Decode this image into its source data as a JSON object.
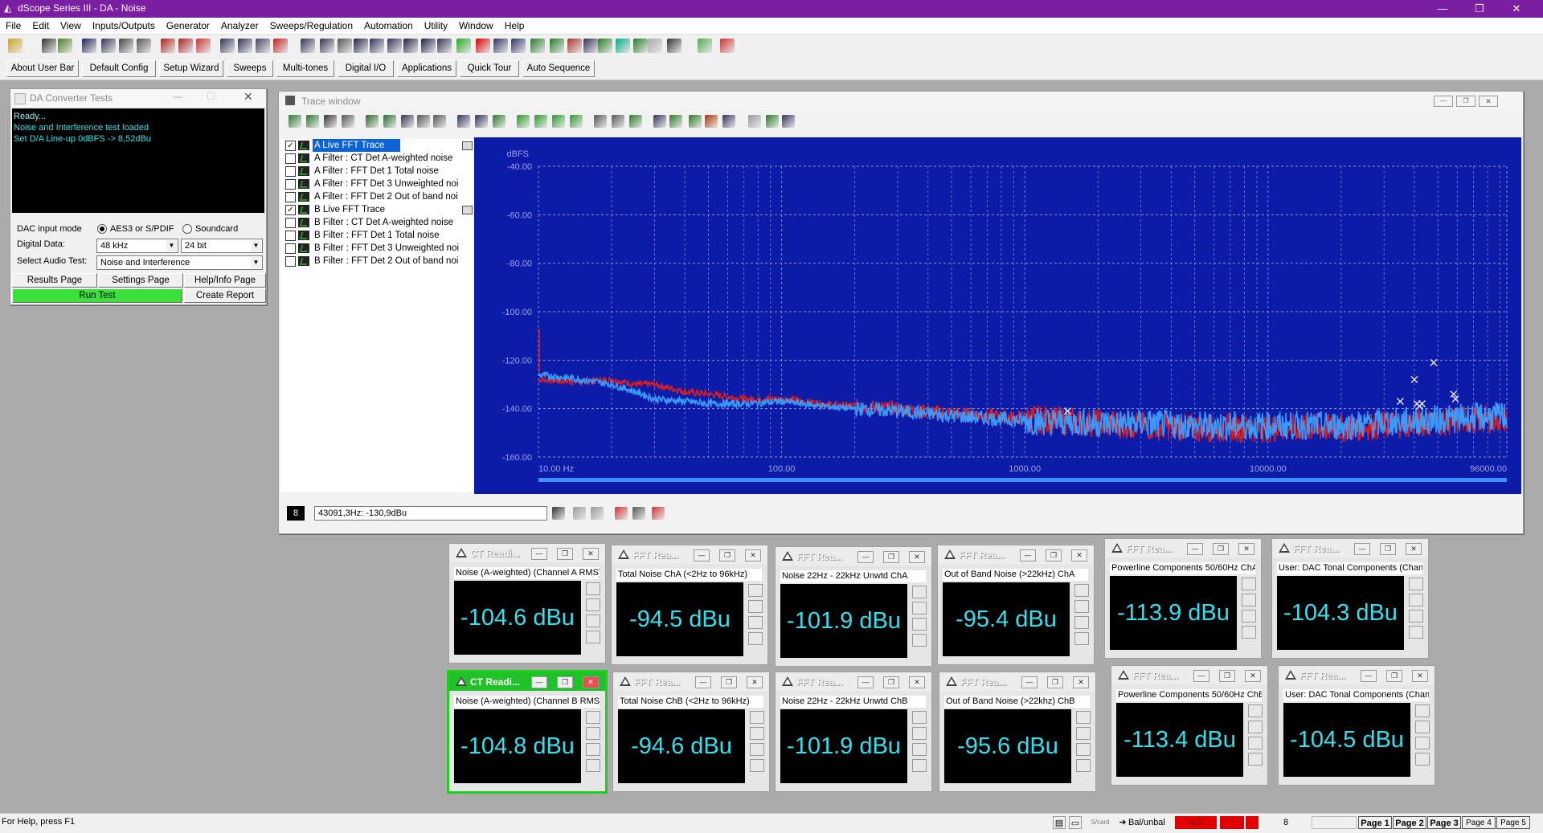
{
  "app": {
    "title": "dScope Series III - DA - Noise"
  },
  "menu": [
    "File",
    "Edit",
    "View",
    "Inputs/Outputs",
    "Generator",
    "Analyzer",
    "Sweeps/Regulation",
    "Automation",
    "Utility",
    "Window",
    "Help"
  ],
  "userbar": [
    "About User Bar",
    "Default Config",
    "Setup Wizard",
    "Sweeps",
    "Multi-tones",
    "Digital I/O",
    "Applications",
    "Quick Tour",
    "Auto Sequence"
  ],
  "da_panel": {
    "title": "DA Converter Tests",
    "log": [
      "Ready...",
      "Noise and Interference test loaded",
      "Set D/A Line-up 0dBFS -> 8,52dBu"
    ],
    "dac_input_label": "DAC input mode",
    "radio1": "AES3 or S/PDIF",
    "radio2": "Soundcard",
    "digital_data_label": "Digital Data:",
    "sample_rate": "48 kHz",
    "bit_depth": "24 bit",
    "audio_test_label": "Select Audio Test:",
    "audio_test": "Noise and Interference",
    "results_btn": "Results Page",
    "settings_btn": "Settings Page",
    "help_btn": "Help/Info Page",
    "run_btn": "Run Test",
    "report_btn": "Create Report"
  },
  "trace_window": {
    "title": "Trace window",
    "traces": [
      {
        "label": "A  Live FFT Trace",
        "checked": true,
        "selected": true
      },
      {
        "label": "A  Filter : CT Det A-weighted noise",
        "checked": false,
        "selected": false
      },
      {
        "label": "A  Filter : FFT Det 1 Total noise",
        "checked": false,
        "selected": false
      },
      {
        "label": "A  Filter : FFT Det 3 Unweighted noi",
        "checked": false,
        "selected": false
      },
      {
        "label": "A  Filter : FFT Det 2 Out of band noi",
        "checked": false,
        "selected": false
      },
      {
        "label": "B  Live FFT Trace",
        "checked": true,
        "selected": false
      },
      {
        "label": "B  Filter : CT Det A-weighted noise",
        "checked": false,
        "selected": false
      },
      {
        "label": "B  Filter : FFT Det 1 Total noise",
        "checked": false,
        "selected": false
      },
      {
        "label": "B  Filter : FFT Det 3 Unweighted noi",
        "checked": false,
        "selected": false
      },
      {
        "label": "B  Filter : FFT Det 2 Out of band noi",
        "checked": false,
        "selected": false
      }
    ],
    "cursor_num": "8",
    "cursor_readout": "43091,3Hz: -130,9dBu"
  },
  "chart_data": {
    "type": "line",
    "ylabel": "dBFS",
    "ylim": [
      -160,
      -40
    ],
    "yticks": [
      "-40.00",
      "-60.00",
      "-80.00",
      "-100.00",
      "-120.00",
      "-140.00",
      "-160.00"
    ],
    "xscale": "log",
    "xlim": [
      10,
      96000
    ],
    "xticks": [
      "10.00 Hz",
      "100.00",
      "1000.00",
      "10000.00",
      "96000.00"
    ],
    "grid": true,
    "colors": {
      "background": "#0d1ca8",
      "series_a": "#e02020",
      "series_b": "#3aa0ff",
      "grid": "#8a93d8"
    },
    "series": [
      {
        "name": "A  Live FFT Trace",
        "x": [
          10,
          15,
          20,
          25,
          30,
          40,
          50,
          70,
          100,
          150,
          200,
          300,
          500,
          1000,
          2000,
          3000,
          5000,
          10000,
          20000,
          40000,
          60000,
          96000
        ],
        "y": [
          -128,
          -129,
          -128,
          -130,
          -130,
          -133,
          -134,
          -136,
          -136,
          -138,
          -139,
          -140,
          -142,
          -144,
          -146,
          -147,
          -148,
          -148,
          -148,
          -146,
          -145,
          -144
        ]
      },
      {
        "name": "B  Live FFT Trace",
        "x": [
          10,
          15,
          20,
          25,
          30,
          40,
          50,
          70,
          100,
          150,
          200,
          300,
          500,
          1000,
          2000,
          3000,
          5000,
          10000,
          20000,
          40000,
          60000,
          96000
        ],
        "y": [
          -126,
          -128,
          -130,
          -133,
          -136,
          -137,
          -138,
          -138,
          -137,
          -139,
          -140,
          -141,
          -143,
          -145,
          -146,
          -146,
          -147,
          -147,
          -147,
          -145,
          -144,
          -143
        ]
      }
    ],
    "markers": [
      {
        "x": 1500,
        "y": -141
      },
      {
        "x": 48000,
        "y": -121
      },
      {
        "x": 40000,
        "y": -128
      },
      {
        "x": 35000,
        "y": -137
      },
      {
        "x": 41000,
        "y": -138
      },
      {
        "x": 42000,
        "y": -139
      },
      {
        "x": 43000,
        "y": -138
      },
      {
        "x": 58000,
        "y": -134
      },
      {
        "x": 59000,
        "y": -136
      }
    ]
  },
  "readouts": [
    {
      "title": "CT Readi...",
      "label": "Noise (A-weighted) (Channel A RMS)",
      "value": "-104.6 dBu",
      "active": false
    },
    {
      "title": "FFT Rea...",
      "label": "Total Noise ChA  (<2Hz to 96kHz)",
      "value": "-94.5 dBu",
      "active": false
    },
    {
      "title": "FFT Rea...",
      "label": "Noise 22Hz - 22kHz Unwtd ChA",
      "value": "-101.9 dBu",
      "active": false
    },
    {
      "title": "FFT Rea...",
      "label": "Out of Band Noise (>22kHz) ChA",
      "value": "-95.4 dBu",
      "active": false
    },
    {
      "title": "FFT Rea...",
      "label": "Powerline Components 50/60Hz ChA",
      "value": "-113.9 dBu",
      "active": false
    },
    {
      "title": "FFT Rea...",
      "label": "User: DAC Tonal Components (Channe",
      "value": "-104.3 dBu",
      "active": false
    },
    {
      "title": "CT Readi...",
      "label": "Noise (A-weighted) (Channel B RMS)",
      "value": "-104.8 dBu",
      "active": true
    },
    {
      "title": "FFT Rea...",
      "label": "Total Noise ChB  (<2Hz to 96kHz)",
      "value": "-94.6 dBu",
      "active": false
    },
    {
      "title": "FFT Rea...",
      "label": "Noise 22Hz - 22kHz Unwtd ChB",
      "value": "-101.9 dBu",
      "active": false
    },
    {
      "title": "FFT Rea...",
      "label": "Out of Band Noise (>22khz) ChB",
      "value": "-95.6 dBu",
      "active": false
    },
    {
      "title": "FFT Rea...",
      "label": "Powerline Components 50/60Hz ChB",
      "value": "-113.4 dBu",
      "active": false
    },
    {
      "title": "FFT Rea...",
      "label": "User: DAC Tonal Components (Channe",
      "value": "-104.5 dBu",
      "active": false
    }
  ],
  "status": {
    "help": "For Help, press F1",
    "scard": "S/card",
    "balunbal": "Bal/unbal",
    "xlr": "XLR",
    "num": "8",
    "pages": [
      "Page 1",
      "Page 2",
      "Page 3",
      "Page 4",
      "Page 5"
    ]
  }
}
